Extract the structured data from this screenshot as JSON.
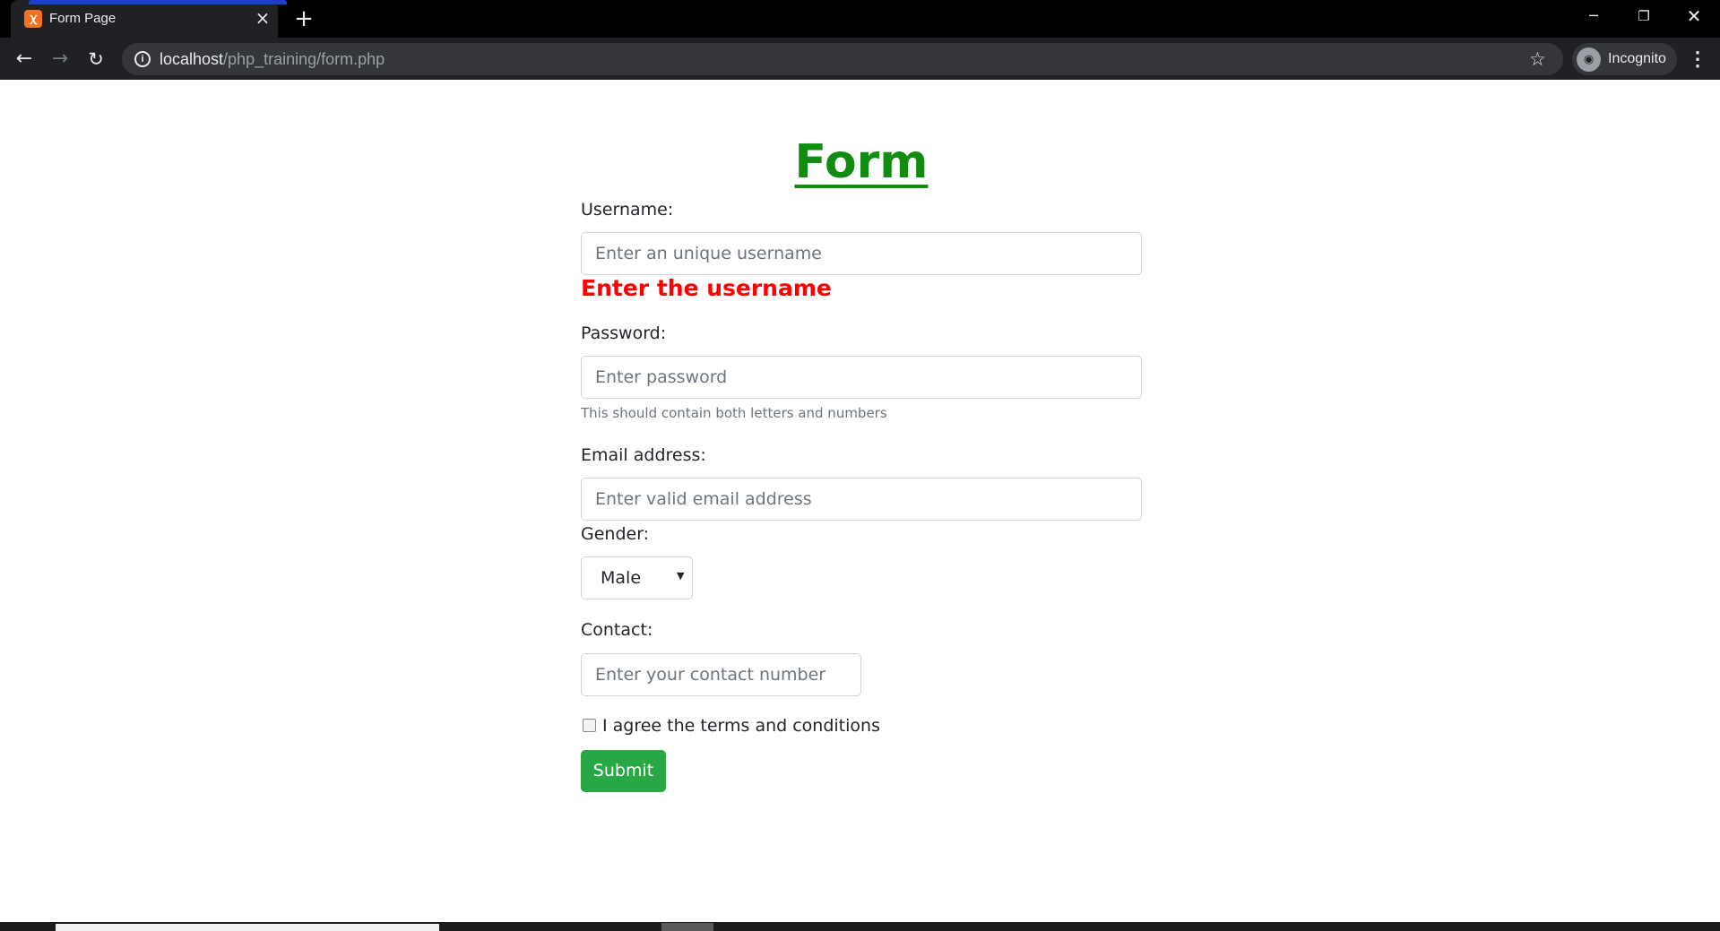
{
  "browser": {
    "tab_title": "Form Page",
    "favicon": "xampp-icon",
    "url_host": "localhost",
    "url_path": "/php_training/form.php",
    "incognito_label": "Incognito"
  },
  "form": {
    "title": "Form",
    "username": {
      "label": "Username:",
      "placeholder": "Enter an unique username",
      "error": "Enter the username"
    },
    "password": {
      "label": "Password:",
      "placeholder": "Enter password",
      "hint": "This should contain both letters and numbers"
    },
    "email": {
      "label": "Email address:",
      "placeholder": "Enter valid email address"
    },
    "gender": {
      "label": "Gender:",
      "selected": "Male"
    },
    "contact": {
      "label": "Contact:",
      "placeholder": "Enter your contact number"
    },
    "terms_label": "I agree the terms and conditions",
    "terms_checked": false,
    "submit_label": "Submit"
  },
  "colors": {
    "title": "#118c11",
    "error": "#ff0000",
    "submit": "#28a745"
  }
}
